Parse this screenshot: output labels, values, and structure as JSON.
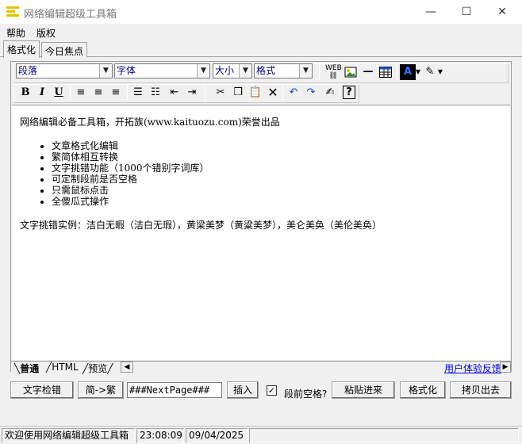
{
  "window": {
    "title": "网络编辑超级工具箱",
    "minimize": "—",
    "maximize": "☐",
    "close": "✕"
  },
  "menu": [
    "帮助",
    "版权"
  ],
  "tabs": [
    "格式化",
    "今日焦点"
  ],
  "toolbar": {
    "paragraph": "段落",
    "font": "字体",
    "size": "大小",
    "format": "格式",
    "icons": {
      "bold": "B",
      "italic": "I",
      "underline": "U"
    }
  },
  "editor": {
    "intro": "网络编辑必备工具箱，开拓族(www.kaituozu.com)荣誉出品",
    "features": [
      "文章格式化编辑",
      "繁简体相互转换",
      "文字挑错功能（1000个错别字词库）",
      "可定制段前是否空格",
      "只需鼠标点击",
      "全傻瓜式操作"
    ],
    "example": "文字挑错实例：洁白无暇（洁白无瑕），黄梁美梦（黄粱美梦），美仑美奂（美伦美奂）"
  },
  "mode_tabs": [
    "普通",
    "HTML",
    "预览"
  ],
  "feedback_link": "用户体验反馈",
  "buttons": {
    "spellcheck": "文字检错",
    "simp_to_trad": "简->繁",
    "nextpage_value": "###NextPage###",
    "insert": "插入",
    "indent_label": "段前空格?",
    "paste": "粘贴进来",
    "format": "格式化",
    "copy_out": "拷贝出去"
  },
  "status": {
    "message": "欢迎使用网络编辑超级工具箱",
    "time": "23:08:09",
    "date": "09/04/2025"
  }
}
